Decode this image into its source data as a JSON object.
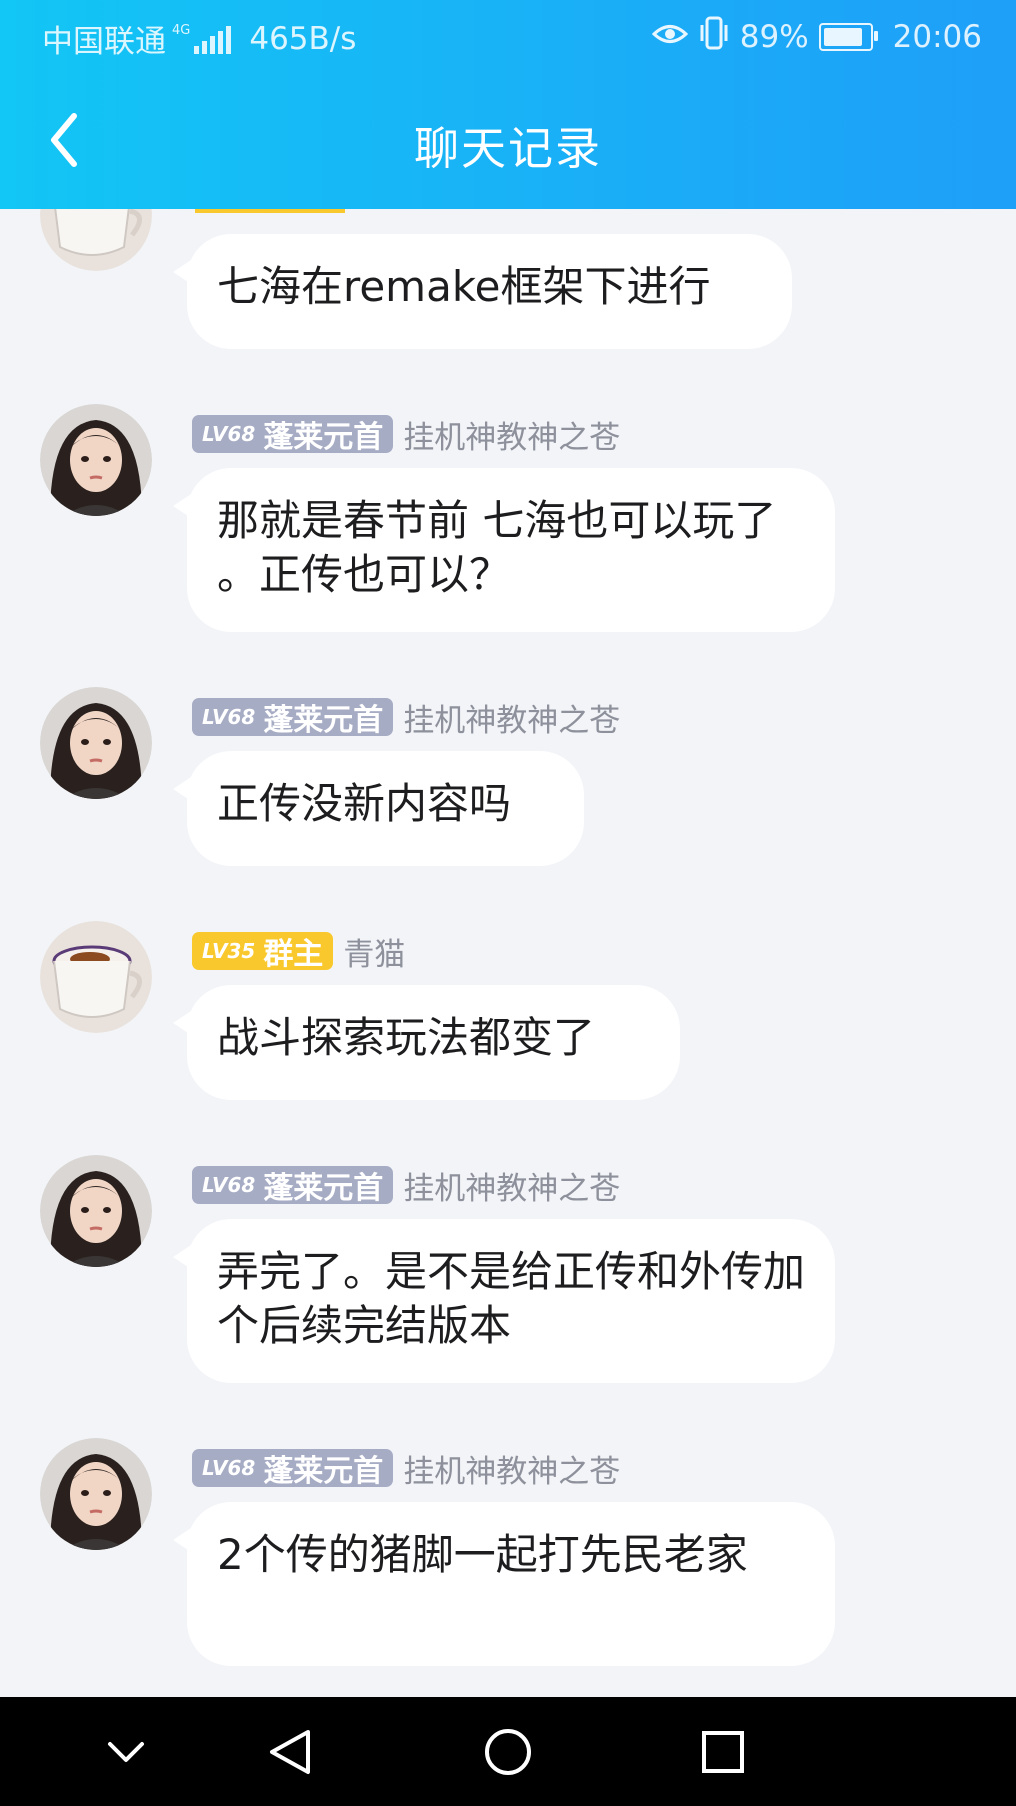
{
  "status_bar": {
    "carrier": "中国联通",
    "network": "4G",
    "speed": "465B/s",
    "battery": "89%",
    "time": "20:06"
  },
  "header": {
    "title": "聊天记录"
  },
  "messages": [
    {
      "text": "七海在remake框架下进行"
    },
    {
      "level": "LV68",
      "badge": "蓬莱元首",
      "sender": "挂机神教神之苍",
      "text": "那就是春节前 七海也可以玩了 。正传也可以？"
    },
    {
      "level": "LV68",
      "badge": "蓬莱元首",
      "sender": "挂机神教神之苍",
      "text": "正传没新内容吗"
    },
    {
      "level": "LV35",
      "badge": "群主",
      "sender": "青猫",
      "text": "战斗探索玩法都变了"
    },
    {
      "level": "LV68",
      "badge": "蓬莱元首",
      "sender": "挂机神教神之苍",
      "text": "弄完了。是不是给正传和外传加个后续完结版本"
    },
    {
      "level": "LV68",
      "badge": "蓬莱元首",
      "sender": "挂机神教神之苍",
      "text": "2个传的猪脚一起打先民老家"
    }
  ],
  "colors": {
    "header_start": "#12c6f5",
    "header_end": "#1e9ff8",
    "badge_gray": "#a7acc5",
    "badge_gold": "#f9c82c",
    "chat_bg": "#f2f4f8"
  },
  "icons": [
    "back-arrow-icon",
    "eye-icon",
    "vibrate-icon",
    "battery-icon",
    "chevron-down-icon",
    "nav-back-icon",
    "nav-home-icon",
    "nav-recents-icon"
  ]
}
